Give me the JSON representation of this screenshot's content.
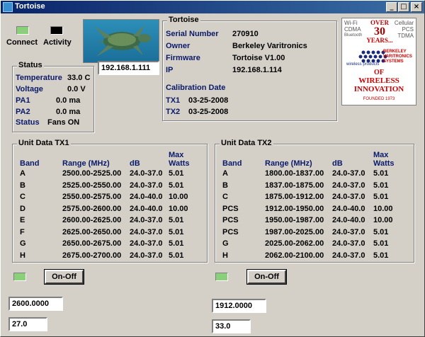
{
  "window": {
    "title": "Tortoise"
  },
  "indicators": {
    "connect_label": "Connect",
    "activity_label": "Activity"
  },
  "ip_input": {
    "value": "192.168.1.111"
  },
  "status": {
    "title": "Status",
    "rows": [
      {
        "label": "Temperature",
        "value": "33.0 C"
      },
      {
        "label": "Voltage",
        "value": "0.0 V"
      },
      {
        "label": "PA1",
        "value": "0.0 ma"
      },
      {
        "label": "PA2",
        "value": "0.0 ma"
      },
      {
        "label": "Status",
        "value": "Fans ON"
      }
    ]
  },
  "device": {
    "title": "Tortoise",
    "rows": [
      {
        "label": "Serial Number",
        "value": "270910"
      },
      {
        "label": "Owner",
        "value": "Berkeley Varitronics"
      },
      {
        "label": "Firmware",
        "value": "Tortoise V1.00"
      },
      {
        "label": "IP",
        "value": "192.168.1.114"
      }
    ],
    "calibration_label": "Calibration Date",
    "calibration": [
      {
        "label": "TX1",
        "value": "03-25-2008"
      },
      {
        "label": "TX2",
        "value": "03-25-2008"
      }
    ]
  },
  "logo": {
    "left_lines": [
      "Wi-Fi",
      "CDMA",
      "Bluetooth"
    ],
    "right_lines": [
      "Cellular",
      "PCS",
      "TDMA"
    ],
    "over": "Over",
    "thirty": "30",
    "years": "Years...",
    "brand1": "Berkeley",
    "brand2": "Varitronics",
    "brand3": "Systems",
    "products": "wireless products",
    "of": "of",
    "wireless": "Wireless",
    "innovation": "Innovation",
    "founded": "Founded 1973"
  },
  "columns": {
    "band": "Band",
    "range": "Range (MHz)",
    "db": "dB",
    "max1": "Max",
    "max2": "Watts"
  },
  "tx1": {
    "title": "Unit Data TX1",
    "rows": [
      {
        "band": "A",
        "range": "2500.00-2525.00",
        "db": "24.0-37.0",
        "watts": "5.01"
      },
      {
        "band": "B",
        "range": "2525.00-2550.00",
        "db": "24.0-37.0",
        "watts": "5.01"
      },
      {
        "band": "C",
        "range": "2550.00-2575.00",
        "db": "24.0-40.0",
        "watts": "10.00"
      },
      {
        "band": "D",
        "range": "2575.00-2600.00",
        "db": "24.0-40.0",
        "watts": "10.00"
      },
      {
        "band": "E",
        "range": "2600.00-2625.00",
        "db": "24.0-37.0",
        "watts": "5.01"
      },
      {
        "band": "F",
        "range": "2625.00-2650.00",
        "db": "24.0-37.0",
        "watts": "5.01"
      },
      {
        "band": "G",
        "range": "2650.00-2675.00",
        "db": "24.0-37.0",
        "watts": "5.01"
      },
      {
        "band": "H",
        "range": "2675.00-2700.00",
        "db": "24.0-37.0",
        "watts": "5.01"
      }
    ],
    "button": "On-Off",
    "freq": "2600.0000",
    "power": "27.0"
  },
  "tx2": {
    "title": "Unit Data TX2",
    "rows": [
      {
        "band": "A",
        "range": "1800.00-1837.00",
        "db": "24.0-37.0",
        "watts": "5.01"
      },
      {
        "band": "B",
        "range": "1837.00-1875.00",
        "db": "24.0-37.0",
        "watts": "5.01"
      },
      {
        "band": "C",
        "range": "1875.00-1912.00",
        "db": "24.0-37.0",
        "watts": "5.01"
      },
      {
        "band": "PCS",
        "range": "1912.00-1950.00",
        "db": "24.0-40.0",
        "watts": "10.00"
      },
      {
        "band": "PCS",
        "range": "1950.00-1987.00",
        "db": "24.0-40.0",
        "watts": "10.00"
      },
      {
        "band": "PCS",
        "range": "1987.00-2025.00",
        "db": "24.0-37.0",
        "watts": "5.01"
      },
      {
        "band": "G",
        "range": "2025.00-2062.00",
        "db": "24.0-37.0",
        "watts": "5.01"
      },
      {
        "band": "H",
        "range": "2062.00-2100.00",
        "db": "24.0-37.0",
        "watts": "5.01"
      }
    ],
    "button": "On-Off",
    "freq": "1912.0000",
    "power": "33.0"
  }
}
